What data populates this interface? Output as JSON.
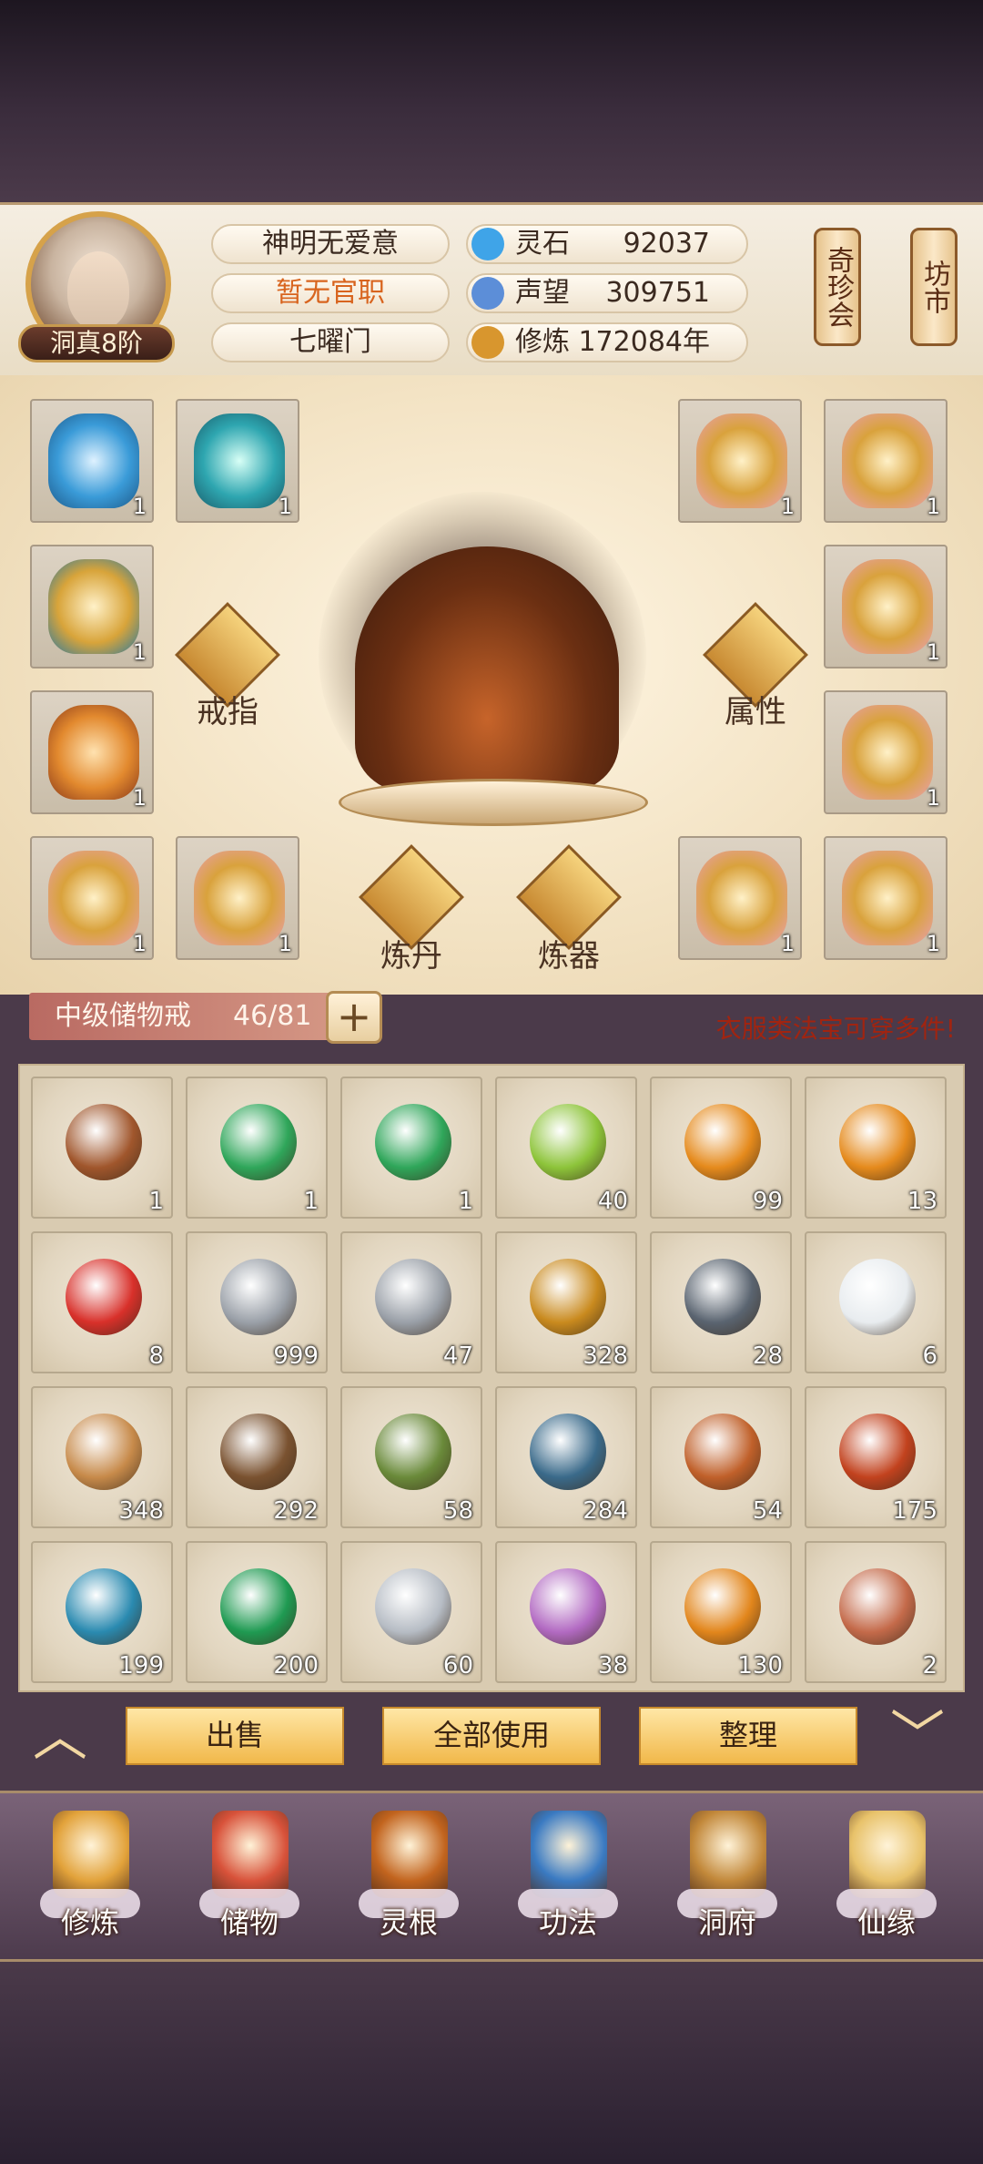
{
  "player": {
    "rank": "洞真8阶",
    "name": "神明无爱意",
    "title": "暂无官职",
    "sect": "七曜门"
  },
  "resources": [
    {
      "label": "灵石",
      "value": "92037",
      "icon": "spirit-stone-icon",
      "color": "#3fa4e8"
    },
    {
      "label": "声望",
      "value": "309751",
      "icon": "prestige-icon",
      "color": "#5c8ed8"
    },
    {
      "label": "修炼",
      "value": "172084年",
      "icon": "meditation-icon",
      "color": "#d8962e"
    }
  ],
  "side_buttons": {
    "treasure": "奇珍会",
    "market": "坊市"
  },
  "equipment": {
    "labels": {
      "ring": "戒指",
      "attr": "属性",
      "alchemy": "炼丹",
      "forge": "炼器"
    },
    "left_slots": [
      {
        "item": "blue-ring",
        "count": "1",
        "color": "#3a9bd8"
      },
      {
        "item": "teal-ring",
        "count": "1",
        "color": "#2ea6b0"
      },
      {
        "item": "gold-ring",
        "count": "1",
        "color": "#d8a43a"
      },
      {
        "item": "bow",
        "count": "1",
        "color": "#e2892e"
      },
      {
        "item": "robe",
        "count": "1",
        "color": "#d9a23c"
      },
      {
        "item": "robe",
        "count": "1",
        "color": "#d9a23c"
      }
    ],
    "right_slots": [
      {
        "item": "robe",
        "count": "1",
        "color": "#d9a23c"
      },
      {
        "item": "robe",
        "count": "1",
        "color": "#d9a23c"
      },
      {
        "item": "robe",
        "count": "1",
        "color": "#d9a23c"
      },
      {
        "item": "robe",
        "count": "1",
        "color": "#d9a23c"
      },
      {
        "item": "robe",
        "count": "1",
        "color": "#d9a23c"
      },
      {
        "item": "robe",
        "count": "1",
        "color": "#d9a23c"
      }
    ]
  },
  "storage": {
    "name": "中级储物戒",
    "capacity": "46/81",
    "plus": "+",
    "hint": "衣服类法宝可穿多件!"
  },
  "inventory": [
    {
      "item": "amber-ring",
      "count": "1",
      "color": "#a0562c"
    },
    {
      "item": "scroll",
      "count": "1",
      "color": "#2fa65a"
    },
    {
      "item": "scroll",
      "count": "1",
      "color": "#2fa65a"
    },
    {
      "item": "green-orb",
      "count": "40",
      "color": "#8dc43a"
    },
    {
      "item": "orange-orb",
      "count": "99",
      "color": "#e58a1c"
    },
    {
      "item": "orange-orb",
      "count": "13",
      "color": "#e58a1c"
    },
    {
      "item": "red-orb",
      "count": "8",
      "color": "#d8302a"
    },
    {
      "item": "grey-ore",
      "count": "999",
      "color": "#9aa0a8"
    },
    {
      "item": "grey-ore",
      "count": "47",
      "color": "#9aa0a8"
    },
    {
      "item": "gold-ore",
      "count": "328",
      "color": "#c98a1e"
    },
    {
      "item": "dark-ore",
      "count": "28",
      "color": "#5a6470"
    },
    {
      "item": "white-flower",
      "count": "6",
      "color": "#e8ecef"
    },
    {
      "item": "ginseng",
      "count": "348",
      "color": "#c78a4a"
    },
    {
      "item": "root",
      "count": "292",
      "color": "#7a5230"
    },
    {
      "item": "herb",
      "count": "58",
      "color": "#6a8a3a"
    },
    {
      "item": "berry-branch",
      "count": "284",
      "color": "#3a6a8a"
    },
    {
      "item": "cordyceps",
      "count": "54",
      "color": "#c0602a"
    },
    {
      "item": "red-crystal",
      "count": "175",
      "color": "#c2421e"
    },
    {
      "item": "blue-crystal",
      "count": "199",
      "color": "#2a8ab0"
    },
    {
      "item": "green-crystal",
      "count": "200",
      "color": "#1f9a52"
    },
    {
      "item": "silver-ore",
      "count": "60",
      "color": "#b6bcc4"
    },
    {
      "item": "lavender-herb",
      "count": "38",
      "color": "#b26ac2"
    },
    {
      "item": "lotus-seed",
      "count": "130",
      "color": "#e2861c"
    },
    {
      "item": "gourd-charm",
      "count": "2",
      "color": "#c46a4a"
    }
  ],
  "actions": {
    "sell": "出售",
    "use_all": "全部使用",
    "sort": "整理"
  },
  "nav": [
    {
      "label": "修炼",
      "icon": "cultivate-icon",
      "color": "#e2a23a"
    },
    {
      "label": "储物",
      "icon": "storage-bag-icon",
      "color": "#d8523a"
    },
    {
      "label": "灵根",
      "icon": "spirit-root-icon",
      "color": "#c2641e"
    },
    {
      "label": "功法",
      "icon": "technique-book-icon",
      "color": "#3a7ac2"
    },
    {
      "label": "洞府",
      "icon": "cave-dwelling-icon",
      "color": "#c2883a"
    },
    {
      "label": "仙缘",
      "icon": "immortal-fate-icon",
      "color": "#e8c26a"
    }
  ]
}
